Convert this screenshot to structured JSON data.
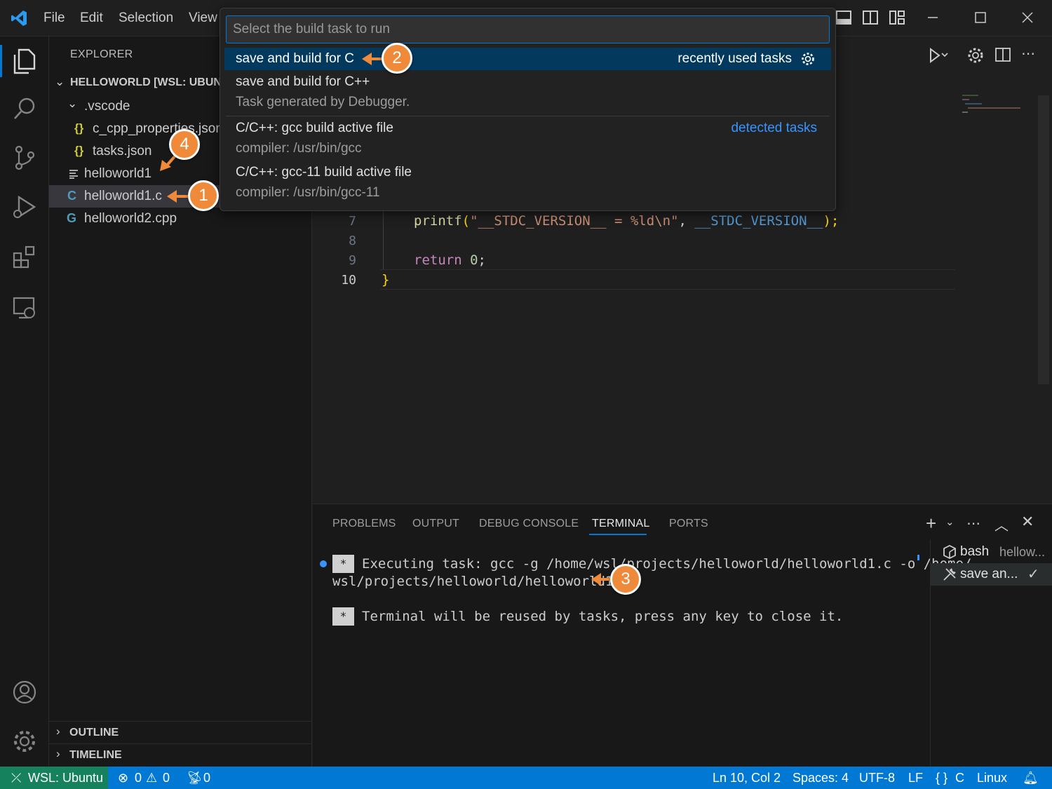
{
  "menu": {
    "file": "File",
    "edit": "Edit",
    "selection": "Selection",
    "view": "View"
  },
  "explorer": {
    "title": "EXPLORER",
    "workspace": "HELLOWORLD [WSL: UBUNT",
    "folder_vscode": ".vscode",
    "file_c_cpp_properties": "c_cpp_properties.json",
    "file_tasks": "tasks.json",
    "file_helloworld1": "helloworld1",
    "file_helloworld1_c": "helloworld1.c",
    "file_helloworld2_cpp": "helloworld2.cpp",
    "outline": "OUTLINE",
    "timeline": "TIMELINE",
    "json_icon_text": "{}",
    "c_icon_text": "C",
    "cpp_icon_text": "G"
  },
  "editor": {
    "lines": [
      {
        "num": "7",
        "fn": "printf",
        "open": "(",
        "str1": "\"__STDC_VERSION__ = %ld\\n\"",
        "comma": ", ",
        "macro": "__STDC_VERSION__",
        "close": ");"
      },
      {
        "num": "8"
      },
      {
        "num": "9",
        "kw": "return",
        "val": "0",
        "semi": ";"
      },
      {
        "num": "10",
        "brace": "}"
      }
    ]
  },
  "quickpick": {
    "placeholder": "Select the build task to run",
    "items": [
      {
        "label": "save and build for C",
        "group": "recently used tasks"
      },
      {
        "label": "save and build for C++",
        "desc": "Task generated by Debugger."
      },
      {
        "label": "C/C++: gcc build active file",
        "desc": "compiler: /usr/bin/gcc",
        "group": "detected tasks"
      },
      {
        "label": "C/C++: gcc-11 build active file",
        "desc": "compiler: /usr/bin/gcc-11"
      }
    ]
  },
  "panel": {
    "tabs": [
      "PROBLEMS",
      "OUTPUT",
      "DEBUG CONSOLE",
      "TERMINAL",
      "PORTS"
    ],
    "active_tab": "TERMINAL",
    "terminal": {
      "star": "*",
      "line1": "Executing task: gcc -g /home/wsl/projects/helloworld/helloworld1.c -o /home/",
      "line2": "wsl/projects/helloworld/helloworld1",
      "line3": "Terminal will be reused by tasks, press any key to close it."
    },
    "terminal_tabs": [
      {
        "label": "bash",
        "detail": "hellow..."
      },
      {
        "label": "save an...",
        "status": "✓"
      }
    ]
  },
  "statusbar": {
    "remote": "WSL: Ubuntu",
    "errors": "0",
    "warnings": "0",
    "ports": "0",
    "position": "Ln 10, Col 2",
    "spaces": "Spaces: 4",
    "encoding": "UTF-8",
    "eol": "LF",
    "language": "C",
    "os": "Linux"
  },
  "callouts": [
    "1",
    "2",
    "3",
    "4"
  ],
  "colors": {
    "accent": "#0078d4",
    "callout": "#ee8a3a",
    "remote": "#16825d",
    "string": "#ce9178",
    "function": "#dcdcaa",
    "keyword": "#c586c0",
    "macro": "#569cd6",
    "number": "#b5cea8",
    "link": "#3794ff"
  }
}
